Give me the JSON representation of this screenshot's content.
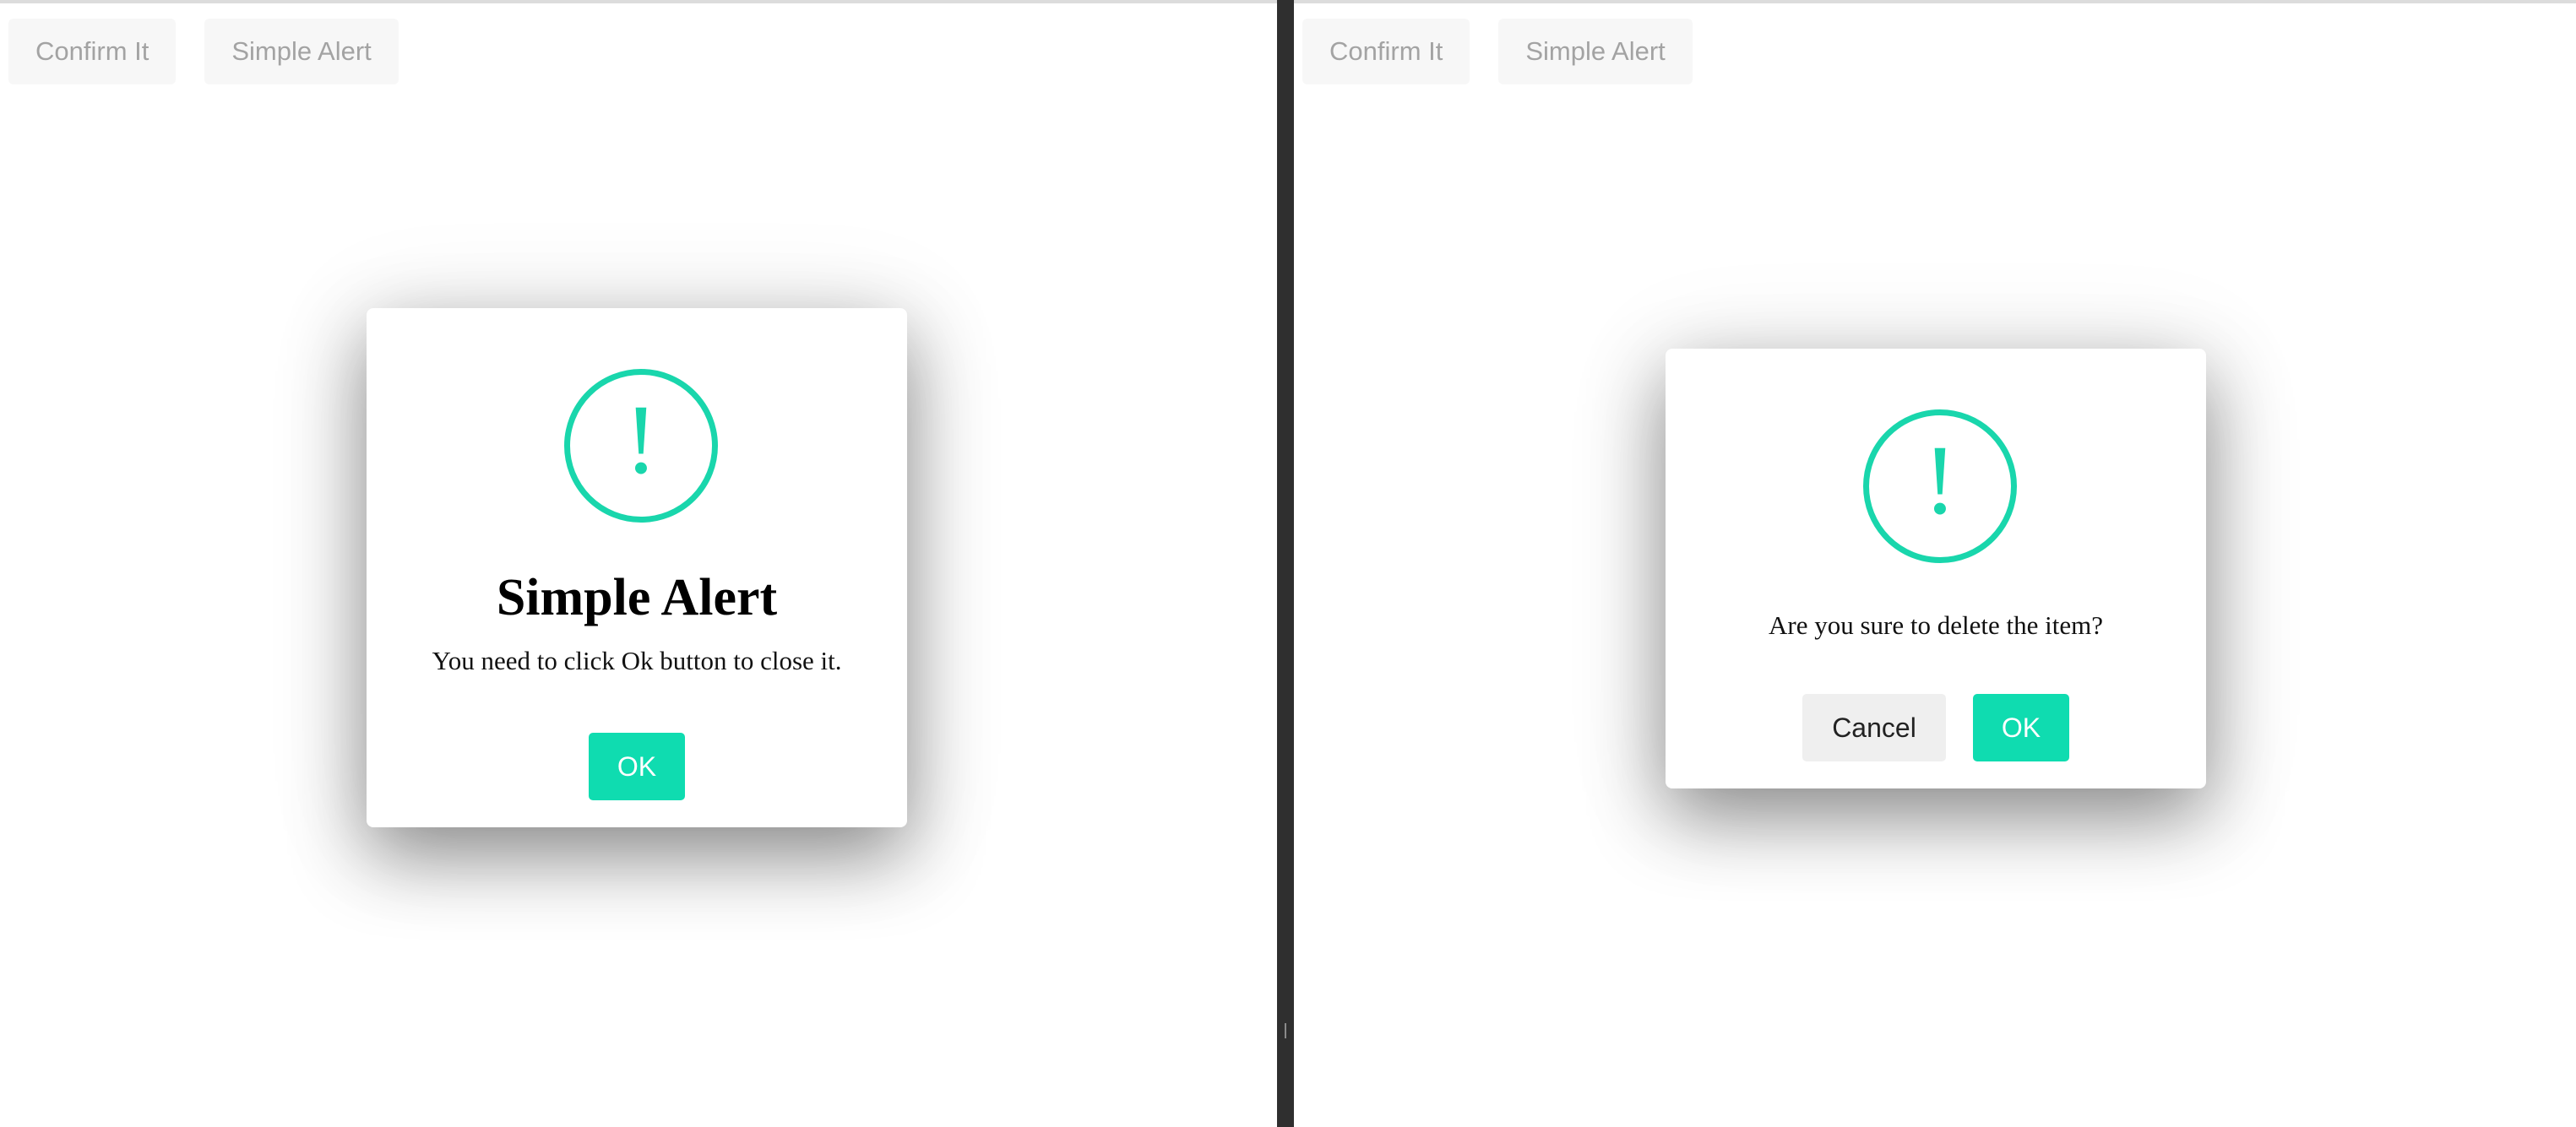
{
  "colors": {
    "accent": "#19d6ac",
    "ok_button": "#0fdcb0",
    "cancel_button": "#efefef",
    "toolbar_button_bg": "#f7f7f7",
    "toolbar_button_text": "#a3a3a3",
    "divider": "#2f2f2f"
  },
  "left_pane": {
    "toolbar": {
      "confirm_label": "Confirm It",
      "alert_label": "Simple Alert"
    },
    "dialog": {
      "icon": "exclamation-circle-icon",
      "icon_glyph": "!",
      "title": "Simple Alert",
      "message": "You need to click Ok button to close it.",
      "ok_label": "OK"
    }
  },
  "right_pane": {
    "toolbar": {
      "confirm_label": "Confirm It",
      "alert_label": "Simple Alert"
    },
    "dialog": {
      "icon": "exclamation-circle-icon",
      "icon_glyph": "!",
      "message": "Are you sure to delete the item?",
      "cancel_label": "Cancel",
      "ok_label": "OK"
    }
  }
}
